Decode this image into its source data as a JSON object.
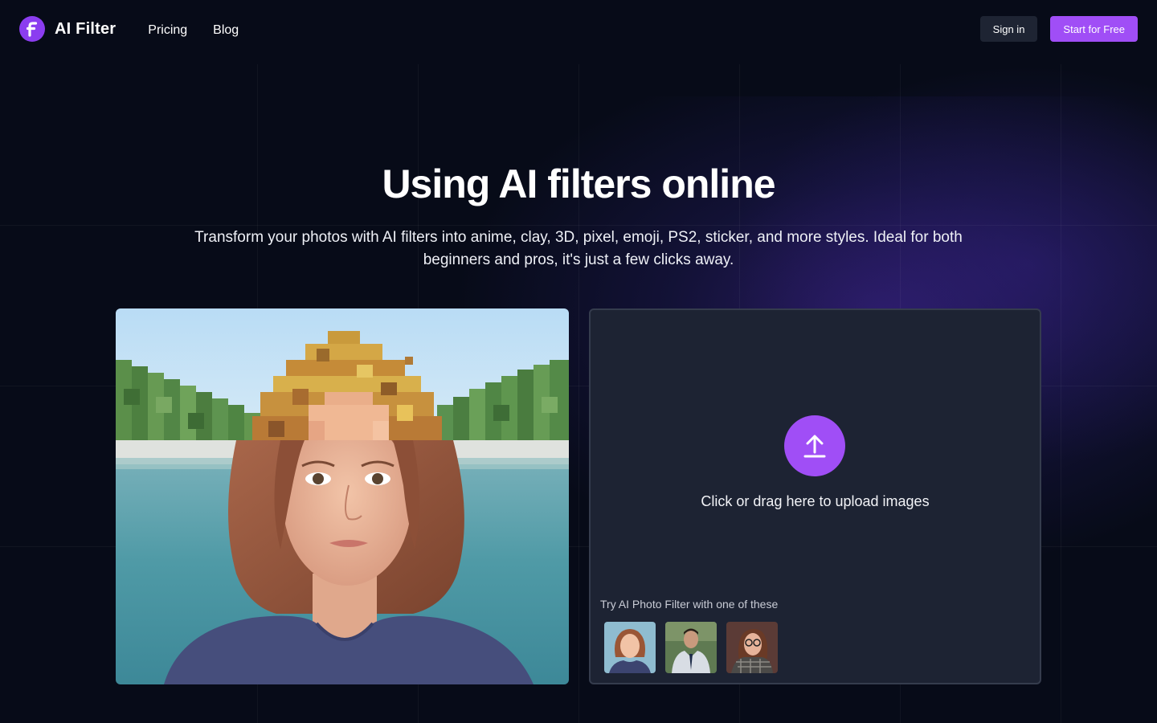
{
  "header": {
    "logo_letter": "F",
    "brand": "AI Filter",
    "nav": [
      {
        "label": "Pricing"
      },
      {
        "label": "Blog"
      }
    ],
    "signin_label": "Sign in",
    "start_label": "Start for Free"
  },
  "hero": {
    "title": "Using AI filters online",
    "subtitle": "Transform your photos with AI filters into anime, clay, 3D, pixel, emoji, PS2, sticker, and more styles. Ideal for both beginners and pros, it's just a few clicks away."
  },
  "upload": {
    "icon": "upload-arrow-icon",
    "prompt": "Click or drag here to upload images",
    "try_label": "Try AI Photo Filter with one of these",
    "samples": [
      "woman-red-hair",
      "man-suit",
      "woman-glasses"
    ]
  },
  "colors": {
    "accent": "#a04ef6",
    "background": "#070b18",
    "panel": "#1d2333"
  }
}
